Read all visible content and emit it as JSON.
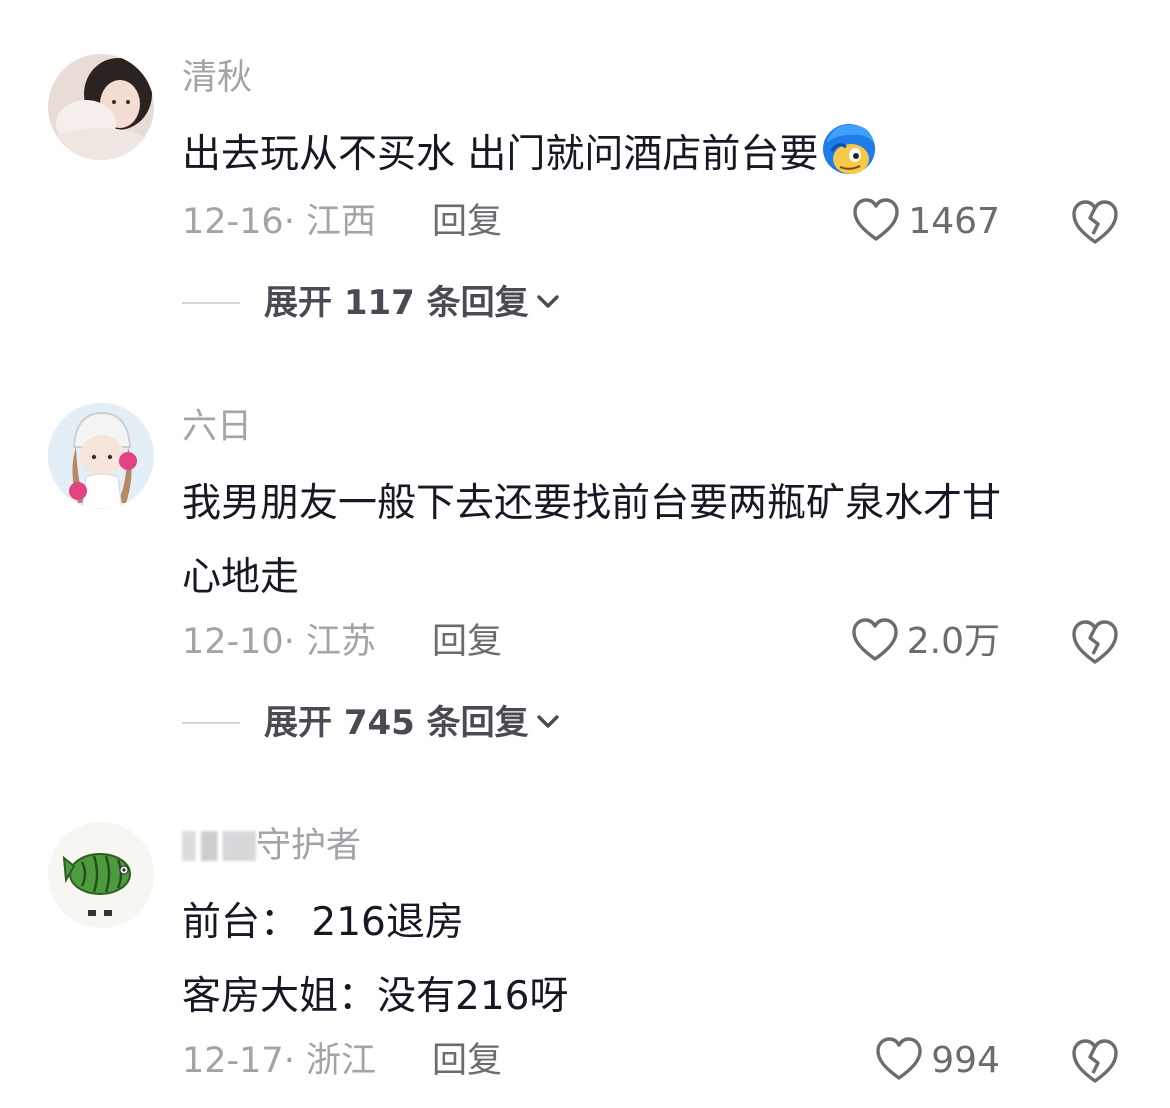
{
  "comments": [
    {
      "username": "清秋",
      "lines": [
        "出去玩从不买水 出门就问酒店前台要"
      ],
      "has_emoji": true,
      "emoji_icon": "blue-hair-face-emoji",
      "date_location": "12-16· 江西",
      "reply_label": "回复",
      "like_count": "1467",
      "expand_label": "展开 117 条回复"
    },
    {
      "username": "六日",
      "lines": [
        "我男朋友一般下去还要找前台要两瓶矿泉水才甘",
        "心地走"
      ],
      "date_location": "12-10· 江苏",
      "reply_label": "回复",
      "like_count": "2.0万",
      "expand_label": "展开 745 条回复"
    },
    {
      "username_visible": "守护者",
      "lines": [
        "前台：  216退房",
        "客房大姐：没有216呀"
      ],
      "date_location": "12-17· 浙江",
      "reply_label": "回复",
      "like_count": "994"
    }
  ],
  "icons": {
    "like": "heart-outline-icon",
    "dislike": "broken-heart-icon",
    "expand": "chevron-down-icon"
  },
  "colors": {
    "text_primary": "#161823",
    "text_secondary": "#a3a3a8",
    "icon": "#6b6b70"
  }
}
